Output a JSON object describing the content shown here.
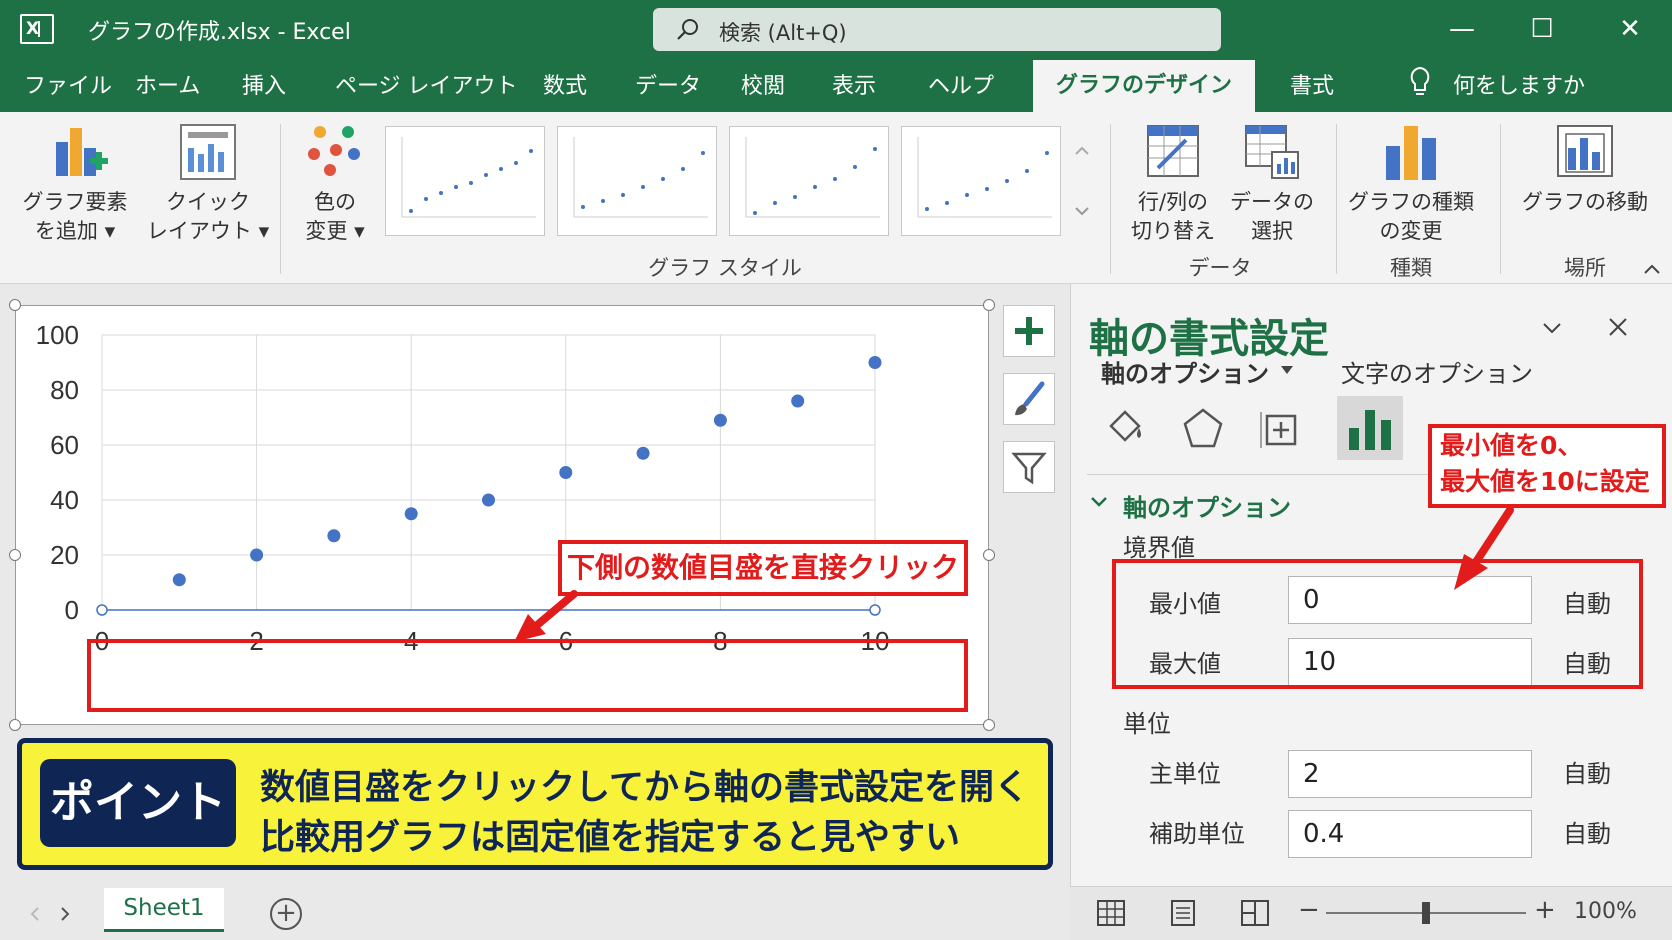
{
  "window": {
    "title": "グラフの作成.xlsx - Excel",
    "search_placeholder": "検索 (Alt+Q)",
    "app_icon_letter": "X",
    "minimize_glyph": "—",
    "maximize_glyph": "☐",
    "close_glyph": "✕"
  },
  "menu": {
    "items": [
      "ファイル",
      "ホーム",
      "挿入",
      "ページ レイアウト",
      "数式",
      "データ",
      "校閲",
      "表示",
      "ヘルプ"
    ],
    "active_tab": "グラフのデザイン",
    "format_tab": "書式",
    "tell_me": "何をしますか"
  },
  "ribbon": {
    "add_element": [
      "グラフ要素",
      "を追加 ▾"
    ],
    "quick_layout": [
      "クイック",
      "レイアウト ▾"
    ],
    "change_color": [
      "色の",
      "変更 ▾"
    ],
    "chart_styles_group": "グラフ スタイル",
    "switch_row_col": [
      "行/列の",
      "切り替え"
    ],
    "select_data": [
      "データの",
      "選択"
    ],
    "data_group": "データ",
    "change_type": [
      "グラフの種類",
      "の変更"
    ],
    "type_group": "種類",
    "move_chart": "グラフの移動",
    "location_group": "場所"
  },
  "chart_data": {
    "type": "scatter",
    "x": [
      1,
      2,
      3,
      4,
      5,
      6,
      7,
      8,
      9,
      10
    ],
    "y": [
      11,
      20,
      27,
      35,
      40,
      50,
      57,
      69,
      76,
      90
    ],
    "xlim": [
      0,
      10
    ],
    "ylim": [
      0,
      100
    ],
    "x_ticks": [
      "0",
      "2",
      "4",
      "6",
      "8",
      "10"
    ],
    "y_ticks": [
      "100",
      "80",
      "60",
      "40",
      "20",
      "0"
    ],
    "grid": true,
    "point_color": "#4472c4"
  },
  "callouts": {
    "axis_click": "下側の数値目盛を直接クリック",
    "min_max": [
      "最小値を0、",
      "最大値を10に設定"
    ]
  },
  "point": {
    "label": "ポイント",
    "line1": "数値目盛をクリックしてから軸の書式設定を開く",
    "line2": "比較用グラフは固定値を指定すると見やすい"
  },
  "sheets": {
    "active": "Sheet1",
    "add_glyph": "+"
  },
  "pane": {
    "title": "軸の書式設定",
    "tab_axis_options": "軸のオプション",
    "tab_text_options": "文字のオプション",
    "section": "軸のオプション",
    "bounds_label": "境界値",
    "min_label": "最小値",
    "min_value": "0",
    "max_label": "最大値",
    "max_value": "10",
    "units_label": "単位",
    "major_label": "主単位",
    "major_value": "2",
    "minor_label": "補助単位",
    "minor_value": "0.4",
    "auto_label": "自動"
  },
  "status": {
    "zoom": "100%",
    "zoom_level_fraction": 0.5
  },
  "colors": {
    "excel_green": "#1e7145",
    "callout_red": "#e21b1b",
    "banner_yellow": "#f9f23a",
    "banner_navy": "#0f2654"
  }
}
